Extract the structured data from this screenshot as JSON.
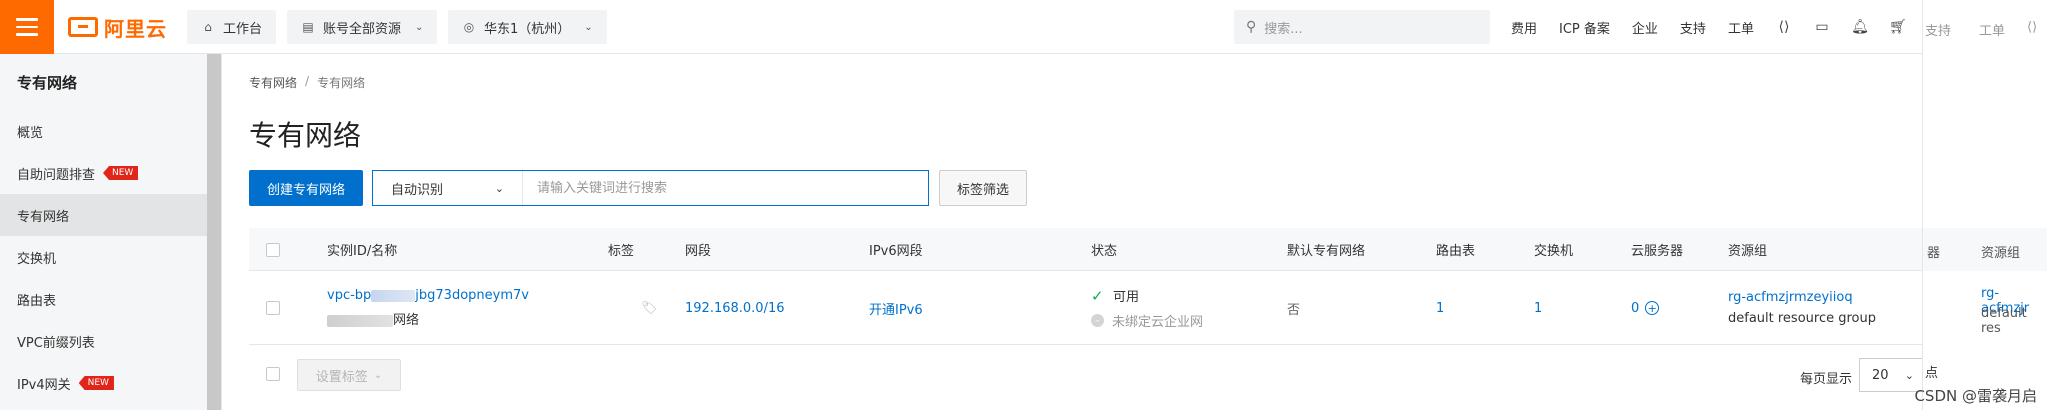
{
  "topbar": {
    "logo_text": "阿里云",
    "workbench": "工作台",
    "resource_scope": "账号全部资源",
    "region": "华东1（杭州）",
    "search_placeholder": "搜索...",
    "links": [
      "费用",
      "ICP 备案",
      "企业",
      "支持",
      "工单"
    ],
    "overlay_links": [
      "支持",
      "工单"
    ]
  },
  "sidebar": {
    "title": "专有网络",
    "items": [
      {
        "label": "概览",
        "badge": ""
      },
      {
        "label": "自助问题排查",
        "badge": "NEW"
      },
      {
        "label": "专有网络",
        "badge": ""
      },
      {
        "label": "交换机",
        "badge": ""
      },
      {
        "label": "路由表",
        "badge": ""
      },
      {
        "label": "VPC前缀列表",
        "badge": ""
      },
      {
        "label": "IPv4网关",
        "badge": "NEW"
      }
    ]
  },
  "main": {
    "breadcrumb": [
      "专有网络",
      "专有网络"
    ],
    "breadcrumb_sep": "/",
    "title": "专有网络",
    "create_button": "创建专有网络",
    "search_mode": "自动识别",
    "search_placeholder": "请输入关键词进行搜索",
    "tag_filter_button": "标签筛选",
    "columns": {
      "id_name": "实例ID/名称",
      "tags": "标签",
      "cidr": "网段",
      "ipv6": "IPv6网段",
      "status": "状态",
      "default_vpc": "默认专有网络",
      "route_tables": "路由表",
      "vswitches": "交换机",
      "ecs": "云服务器",
      "resource_group": "资源组",
      "overlay_col_partial": "器",
      "overlay_col_rg": "资源组"
    },
    "rows": [
      {
        "id_prefix": "vpc-bp",
        "id_suffix": "jbg73dopneym7v",
        "name_suffix": "网络",
        "cidr": "192.168.0.0/16",
        "ipv6": "开通IPv6",
        "status": "可用",
        "cen_status": "未绑定云企业网",
        "default_vpc": "否",
        "route_tables": "1",
        "vswitches": "1",
        "ecs": "0",
        "resource_group_id": "rg-acfmzjrmzeyiioq",
        "resource_group_name": "default resource group",
        "overlay_rg_id": "rg-acfmzjr",
        "overlay_rg_name": "default res"
      }
    ],
    "footer": {
      "set_tags_button": "设置标签",
      "page_size_label": "每页显示",
      "page_size": "20",
      "overlay_partial": "点"
    }
  },
  "watermark": "CSDN @雷袭月启",
  "colors": {
    "brand": "#ff6a00",
    "primary": "#0070cc",
    "success": "#13a854",
    "new_badge": "#e1251b"
  }
}
